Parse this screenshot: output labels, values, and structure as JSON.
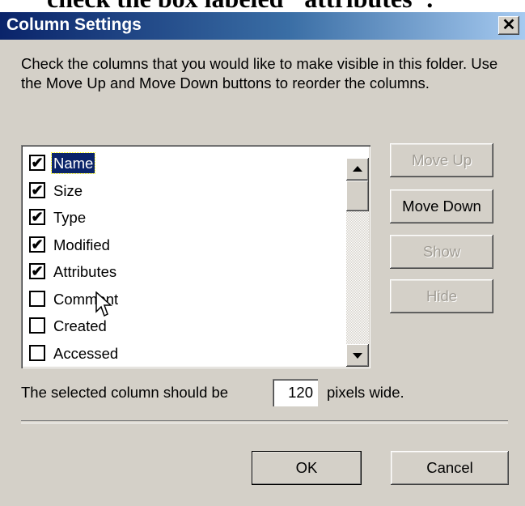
{
  "caption_fragment": "check the box labeled \"attributes\".",
  "window": {
    "title": "Column Settings",
    "close_glyph": "✕"
  },
  "instructions": "Check the columns that you would like to make visible in this folder.  Use the Move Up and Move Down buttons to reorder the columns.",
  "columns": [
    {
      "label": "Name",
      "checked": true,
      "selected": true
    },
    {
      "label": "Size",
      "checked": true,
      "selected": false
    },
    {
      "label": "Type",
      "checked": true,
      "selected": false
    },
    {
      "label": "Modified",
      "checked": true,
      "selected": false
    },
    {
      "label": "Attributes",
      "checked": true,
      "selected": false
    },
    {
      "label": "Comment",
      "checked": false,
      "selected": false
    },
    {
      "label": "Created",
      "checked": false,
      "selected": false
    },
    {
      "label": "Accessed",
      "checked": false,
      "selected": false
    }
  ],
  "buttons": {
    "move_up": "Move Up",
    "move_down": "Move Down",
    "show": "Show",
    "hide": "Hide",
    "ok": "OK",
    "cancel": "Cancel"
  },
  "width_setting": {
    "prefix": "The selected column should be",
    "value": "120",
    "suffix": "pixels wide."
  },
  "icons": {
    "checkbox_checked": "✔",
    "cursor": "arrow-cursor-icon"
  },
  "colors": {
    "title_gradient_start": "#0a246a",
    "title_gradient_end": "#a6caf0",
    "selection": "#0a246a",
    "dialog_face": "#d4d0c8"
  }
}
